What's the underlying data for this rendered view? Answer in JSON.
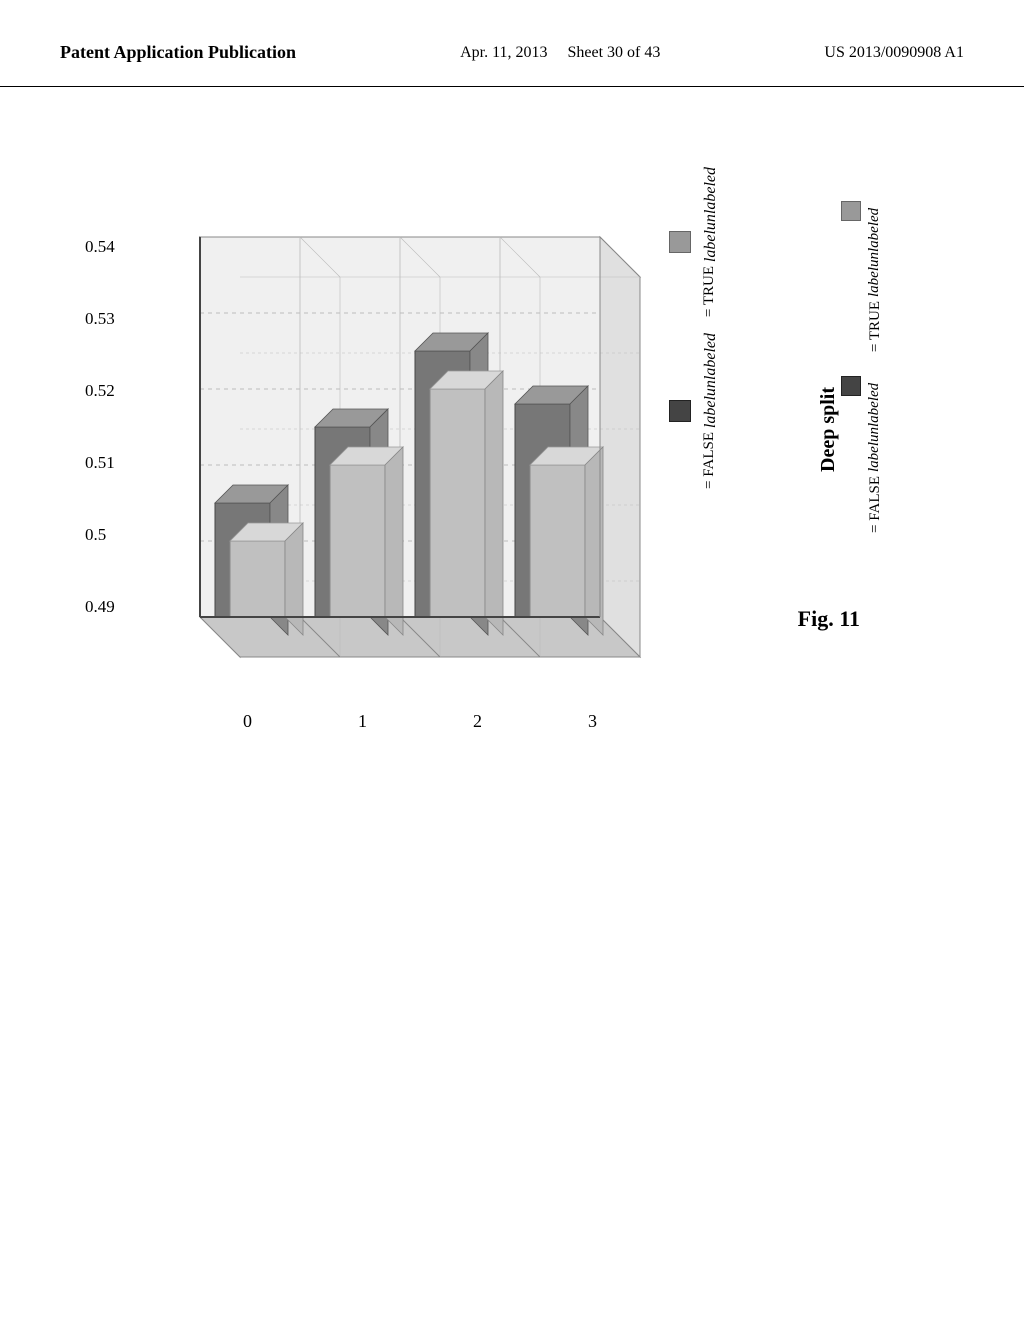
{
  "header": {
    "left": "Patent Application Publication",
    "center_line1": "Apr. 11, 2013",
    "center_line2": "Sheet 30 of 43",
    "right": "US 2013/0090908 A1"
  },
  "legend": {
    "item1": {
      "label": "labelunlabeled",
      "value": "= TRUE",
      "swatch_type": "light"
    },
    "item2": {
      "label": "labelunlabeled",
      "value": "= FALSE",
      "swatch_type": "dark"
    }
  },
  "chart": {
    "y_axis_labels": [
      "0.49",
      "0.5",
      "0.51",
      "0.52",
      "0.53",
      "0.54"
    ],
    "x_axis_labels": [
      "0",
      "1",
      "2",
      "3"
    ],
    "x_axis_title": "Deep split",
    "figure_label": "Fig. 11",
    "bars": {
      "group0": {
        "true_val": 0.5,
        "false_val": 0.505
      },
      "group1": {
        "true_val": 0.51,
        "false_val": 0.515
      },
      "group2": {
        "true_val": 0.52,
        "false_val": 0.525
      },
      "group3": {
        "true_val": 0.51,
        "false_val": 0.518
      }
    }
  }
}
